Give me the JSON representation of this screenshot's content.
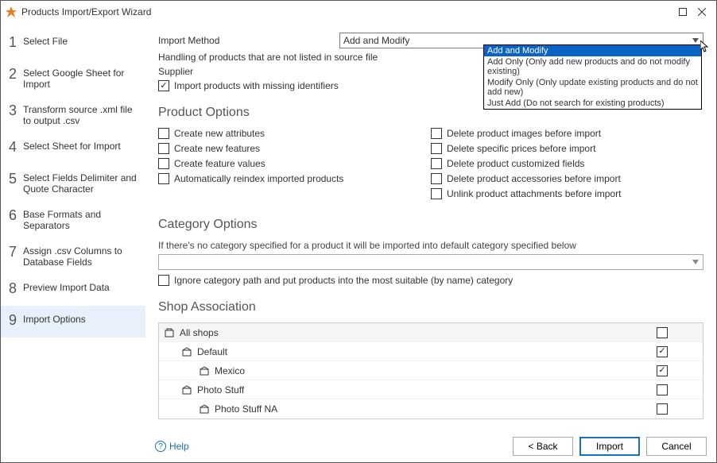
{
  "window": {
    "title": "Products Import/Export Wizard"
  },
  "steps": [
    "Select File",
    "Select Google Sheet for Import",
    "Transform source .xml file to output .csv",
    "Select Sheet for Import",
    "Select Fields Delimiter and Quote Character",
    "Base Formats and Separators",
    "Assign .csv Columns to Database Fields",
    "Preview Import Data",
    "Import Options"
  ],
  "labels": {
    "importMethod": "Import Method",
    "handling": "Handling of products that are not listed in source file",
    "supplier": "Supplier",
    "importMissing": "Import products with missing identifiers"
  },
  "dropdown": {
    "selected": "Add and Modify",
    "options": [
      "Add and Modify",
      "Add Only (Only add new products and do not modify existing)",
      "Modify Only (Only update existing products and do not add new)",
      "Just Add (Do not search for existing products)"
    ]
  },
  "sections": {
    "product": "Product Options",
    "category": "Category Options",
    "shop": "Shop Association"
  },
  "productOptionsLeft": [
    "Create new attributes",
    "Create new features",
    "Create feature values",
    "Automatically reindex imported products"
  ],
  "productOptionsRight": [
    "Delete product images before import",
    "Delete specific prices before import",
    "Delete product customized fields",
    "Delete product accessories before import",
    "Unlink product attachments before import"
  ],
  "category": {
    "hint": "If there's no category specified for a product it will be imported into default category specified below",
    "ignore": "Ignore category path and put products into the most suitable (by name) category"
  },
  "shops": [
    {
      "name": "All shops",
      "indent": 0,
      "checked": false,
      "header": true
    },
    {
      "name": "Default",
      "indent": 1,
      "checked": true,
      "header": false
    },
    {
      "name": "Mexico",
      "indent": 2,
      "checked": true,
      "header": false
    },
    {
      "name": "Photo Stuff",
      "indent": 1,
      "checked": false,
      "header": false
    },
    {
      "name": "Photo Stuff NA",
      "indent": 2,
      "checked": false,
      "header": false
    }
  ],
  "footer": {
    "help": "Help",
    "back": "< Back",
    "import": "Import",
    "cancel": "Cancel"
  }
}
